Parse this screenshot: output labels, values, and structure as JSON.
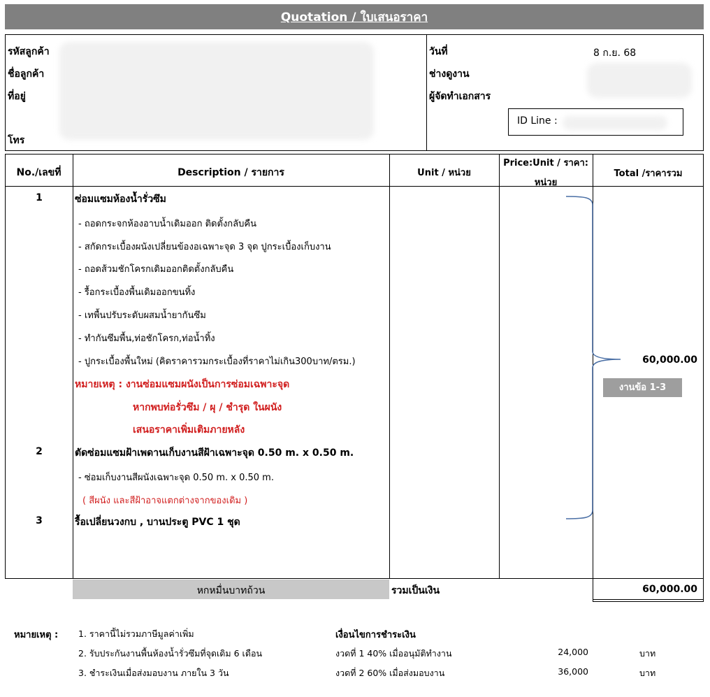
{
  "title": "Quotation / ใบเสนอราคา",
  "customer": {
    "code_label": "รหัสลูกค้า",
    "name_label": "ชื่อลูกค้า",
    "address_label": "ที่อยู่",
    "phone_label": "โทร"
  },
  "meta": {
    "date_label": "วันที่",
    "date_value": "8 ก.ย. 68",
    "surveyor_label": "ช่างดูงาน",
    "preparer_label": "ผู้จัดทำเอกสาร",
    "line_id_label": "ID Line :"
  },
  "table": {
    "headers": {
      "no": "No./เลขที่",
      "description": "Description / รายการ",
      "unit": "Unit / หน่วย",
      "price_line1": "Price:Unit / ราคา:",
      "price_line2": "หน่วย",
      "total": "Total /ราคารวม"
    },
    "item1": {
      "no": "1",
      "title": "ซ่อมแซมห้องน้ำรั่วซึม",
      "details": [
        "- ถอดกระจกห้องอาบน้ำเดิมออก ติดตั้งกลับคืน",
        "- สกัดกระเบื้องผนังเปลี่ยนข้องอเฉพาะจุด 3 จุด ปูกระเบื้องเก็บงาน",
        "- ถอดส้วมชักโครกเดิมออกติดตั้งกลับคืน",
        "- รื้อกระเบื้องพื้นเดิมออกขนทิ้ง",
        "- เทพื้นปรับระดับผสมน้ำยากันซึม",
        "- ทำกันซึมพื้น,ท่อชักโครก,ท่อน้ำทิ้ง",
        "- ปูกระเบื้องพื้นใหม่ (คิดราคารวมกระเบื้องที่ราคาไม่เกิน300บาท/ตรม.)"
      ],
      "note_line1": "หมายเหตุ : งานซ่อมแซมผนังเป็นการซ่อมเฉพาะจุด",
      "note_line2": "หากพบท่อรั่วซึม / ผุ / ชำรุด ในผนัง",
      "note_line3": "เสนอราคาเพิ่มเติมภายหลัง"
    },
    "item2": {
      "no": "2",
      "title": "ตัดซ่อมแซมฝ้าเพดานเก็บงานสีฝ้าเฉพาะจุด 0.50 m. x 0.50 m.",
      "detail": "- ซ่อมเก็บงานสีผนังเฉพาะจุด 0.50 m. x 0.50 m.",
      "note": "( สีผนัง และสีฝ้าอาจแตกต่างจากของเดิม )"
    },
    "item3": {
      "no": "3",
      "title": "รื้อเปลี่ยนวงกบ , บานประตู PVC 1 ชุด"
    },
    "group_total": "60,000.00",
    "group_badge": "งานข้อ 1-3",
    "amount_in_words": "หกหมื่นบาทถ้วน",
    "sum_label": "รวมเป็นเงิน",
    "sum_value": "60,000.00"
  },
  "remarks": {
    "label": "หมายเหตุ :",
    "items": [
      "1. ราคานี้ไม่รวมภาษีมูลค่าเพิ่ม",
      "2. รับประกันงานพื้นห้องน้ำรั่วซึมที่จุดเดิม  6 เดือน",
      "3. ชำระเงินเมื่อส่งมอบงาน ภายใน 3 วัน"
    ]
  },
  "payment": {
    "title": "เงื่อนไขการชำระเงิน",
    "rows": [
      {
        "term": "งวดที่ 1 40% เมื่ออนุมัติทำงาน",
        "amount": "24,000",
        "unit": "บาท"
      },
      {
        "term": "งวดที่ 2 60% เมื่อส่งมอบงาน",
        "amount": "36,000",
        "unit": "บาท"
      }
    ]
  }
}
